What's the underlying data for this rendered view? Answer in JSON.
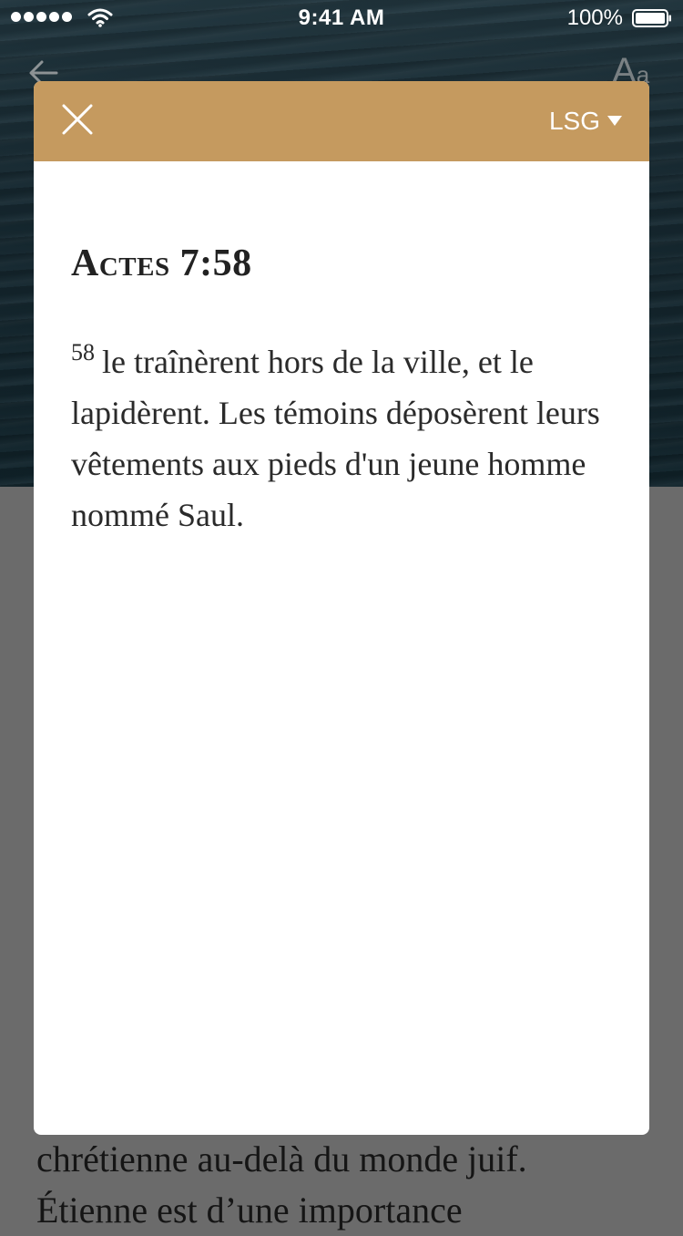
{
  "status_bar": {
    "time": "9:41 AM",
    "battery_percent": "100%"
  },
  "background": {
    "body_text_line_1": "chrétienne au-delà du monde juif.",
    "body_text_line_2": "Étienne est d’une importance",
    "font_size_icon_large": "A",
    "font_size_icon_small": "a"
  },
  "modal": {
    "version_label": "LSG",
    "reference": "Actes 7:58",
    "verse_number": "58",
    "verse_text": "le traînèrent hors de la ville, et le lapidèrent. Les témoins déposèrent leurs vêtements aux pieds d'un jeune homme nommé Saul."
  },
  "colors": {
    "header": "#c59a5f",
    "overlay": "#6b6b6b"
  },
  "icons": {
    "close": "close-icon",
    "caret": "caret-down-icon",
    "back": "back-arrow-icon",
    "wifi": "wifi-icon",
    "battery": "battery-icon",
    "signal": "signal-dots-icon"
  }
}
